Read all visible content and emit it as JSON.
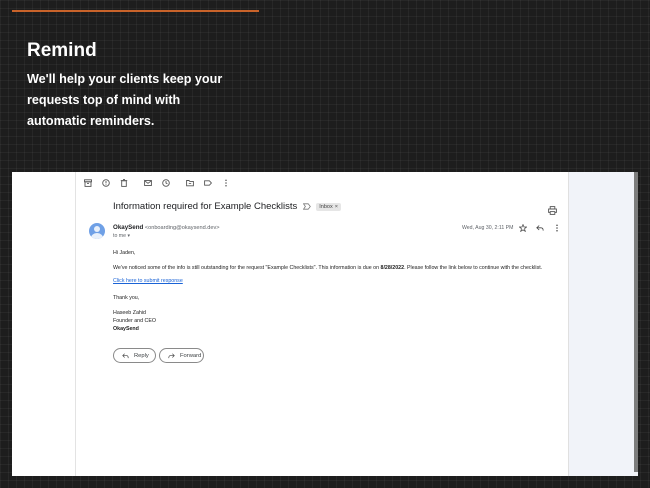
{
  "hero": {
    "title": "Remind",
    "description": "We'll help your clients keep your requests top of mind with automatic reminders."
  },
  "colors": {
    "accent": "#c9632a",
    "link": "#1a63d6",
    "avatar": "#6fa0e6"
  },
  "toolbar": {
    "icons": [
      "archive-icon",
      "report-spam-icon",
      "delete-icon",
      "mark-unread-icon",
      "snooze-icon",
      "move-to-icon",
      "label-icon",
      "more-vert-icon"
    ]
  },
  "email": {
    "subject": "Information required for Example Checklists",
    "inbox_badge": "Inbox",
    "sender_name": "OkaySend",
    "sender_email": "<onboarding@okaysend.dev>",
    "to": "to me",
    "date": "Wed, Aug 30, 2:11 PM",
    "greeting": "Hi Jaden,",
    "body_before": "We've noticed some of the info is still outstanding for the request \"Example Checklists\". This information is due on ",
    "due_date": "8/28/2022",
    "body_after": ". Please follow the link below to continue with the checklist.",
    "link_text": "Click here to submit response",
    "thanks": "Thank you,",
    "signature_name": "Haseeb Zahid",
    "signature_title": "Founder and CEO",
    "signature_company": "OkaySend",
    "reply_label": "Reply",
    "forward_label": "Forward"
  }
}
